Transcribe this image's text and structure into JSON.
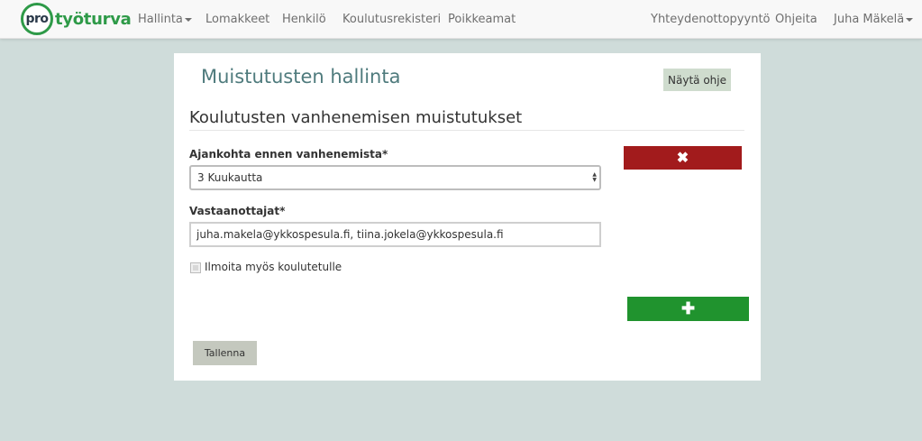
{
  "navbar": {
    "logo": {
      "pro": "pro",
      "name": "työturva"
    },
    "items": [
      {
        "label": "Hallinta",
        "dropdown": true
      },
      {
        "label": "Lomakkeet"
      },
      {
        "label": "Henkilö"
      },
      {
        "label": "Koulutusrekisteri"
      },
      {
        "label": "Poikkeamat"
      }
    ],
    "right": {
      "contact": "Yhteydenottopyyntö",
      "help": "Ohjeita",
      "user": "Juha Mäkelä"
    }
  },
  "page": {
    "title": "Muistutusten hallinta",
    "help_button": "Näytä ohje",
    "section_title": "Koulutusten vanhenemisen muistutukset"
  },
  "form": {
    "timing": {
      "label": "Ajankohta ennen vanhenemista*",
      "value": "3 Kuukautta"
    },
    "recipients": {
      "label": "Vastaanottajat*",
      "value": "juha.makela@ykkospesula.fi, tiina.jokela@ykkospesula.fi"
    },
    "notify_trainee": {
      "label": "Ilmoita myös koulutetulle",
      "checked": false
    },
    "remove_icon": "close-icon",
    "remove_symbol": "✖",
    "add_icon": "plus-icon",
    "add_symbol": "✚",
    "save_label": "Tallenna"
  },
  "colors": {
    "background": "#cfdcda",
    "brand_green": "#2e9a48",
    "title": "#4f7b7d",
    "danger": "#a21b1c",
    "success": "#20932e"
  }
}
